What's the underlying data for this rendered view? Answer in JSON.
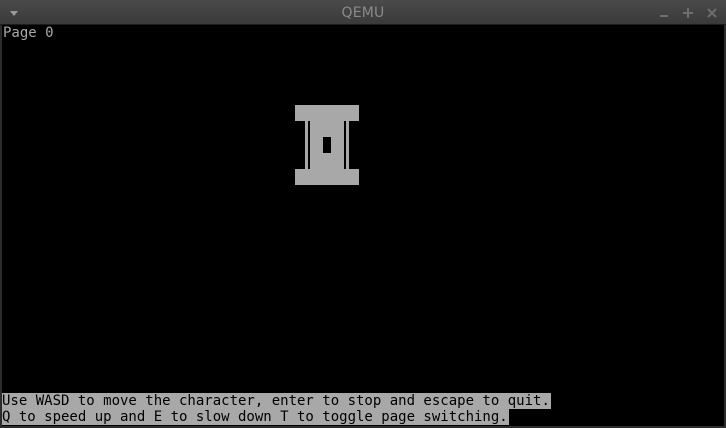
{
  "window": {
    "title": "QEMU",
    "menu_icon": "chevron-down-icon",
    "controls": [
      "minimize-icon",
      "maximize-icon",
      "close-icon"
    ]
  },
  "screen": {
    "page_label": "Page 0",
    "instructions": {
      "line1": "Use WASD to move the character, enter to stop and escape to quit.",
      "line2": "Q to speed up and E to slow down T to toggle page switching."
    },
    "sprite": "pillar-character-icon"
  },
  "colors": {
    "titlebar": "#3a3a3a",
    "title_text": "#8a8a8a",
    "screen_bg": "#000000",
    "vga_text": "#a8a8a8"
  }
}
